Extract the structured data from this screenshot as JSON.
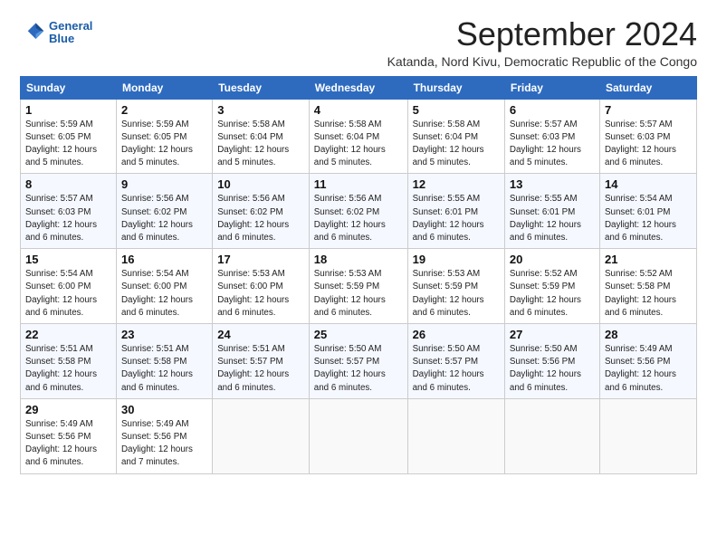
{
  "logo": {
    "line1": "General",
    "line2": "Blue"
  },
  "title": "September 2024",
  "location": "Katanda, Nord Kivu, Democratic Republic of the Congo",
  "headers": [
    "Sunday",
    "Monday",
    "Tuesday",
    "Wednesday",
    "Thursday",
    "Friday",
    "Saturday"
  ],
  "weeks": [
    [
      {
        "day": "1",
        "info": "Sunrise: 5:59 AM\nSunset: 6:05 PM\nDaylight: 12 hours\nand 5 minutes."
      },
      {
        "day": "2",
        "info": "Sunrise: 5:59 AM\nSunset: 6:05 PM\nDaylight: 12 hours\nand 5 minutes."
      },
      {
        "day": "3",
        "info": "Sunrise: 5:58 AM\nSunset: 6:04 PM\nDaylight: 12 hours\nand 5 minutes."
      },
      {
        "day": "4",
        "info": "Sunrise: 5:58 AM\nSunset: 6:04 PM\nDaylight: 12 hours\nand 5 minutes."
      },
      {
        "day": "5",
        "info": "Sunrise: 5:58 AM\nSunset: 6:04 PM\nDaylight: 12 hours\nand 5 minutes."
      },
      {
        "day": "6",
        "info": "Sunrise: 5:57 AM\nSunset: 6:03 PM\nDaylight: 12 hours\nand 5 minutes."
      },
      {
        "day": "7",
        "info": "Sunrise: 5:57 AM\nSunset: 6:03 PM\nDaylight: 12 hours\nand 6 minutes."
      }
    ],
    [
      {
        "day": "8",
        "info": "Sunrise: 5:57 AM\nSunset: 6:03 PM\nDaylight: 12 hours\nand 6 minutes."
      },
      {
        "day": "9",
        "info": "Sunrise: 5:56 AM\nSunset: 6:02 PM\nDaylight: 12 hours\nand 6 minutes."
      },
      {
        "day": "10",
        "info": "Sunrise: 5:56 AM\nSunset: 6:02 PM\nDaylight: 12 hours\nand 6 minutes."
      },
      {
        "day": "11",
        "info": "Sunrise: 5:56 AM\nSunset: 6:02 PM\nDaylight: 12 hours\nand 6 minutes."
      },
      {
        "day": "12",
        "info": "Sunrise: 5:55 AM\nSunset: 6:01 PM\nDaylight: 12 hours\nand 6 minutes."
      },
      {
        "day": "13",
        "info": "Sunrise: 5:55 AM\nSunset: 6:01 PM\nDaylight: 12 hours\nand 6 minutes."
      },
      {
        "day": "14",
        "info": "Sunrise: 5:54 AM\nSunset: 6:01 PM\nDaylight: 12 hours\nand 6 minutes."
      }
    ],
    [
      {
        "day": "15",
        "info": "Sunrise: 5:54 AM\nSunset: 6:00 PM\nDaylight: 12 hours\nand 6 minutes."
      },
      {
        "day": "16",
        "info": "Sunrise: 5:54 AM\nSunset: 6:00 PM\nDaylight: 12 hours\nand 6 minutes."
      },
      {
        "day": "17",
        "info": "Sunrise: 5:53 AM\nSunset: 6:00 PM\nDaylight: 12 hours\nand 6 minutes."
      },
      {
        "day": "18",
        "info": "Sunrise: 5:53 AM\nSunset: 5:59 PM\nDaylight: 12 hours\nand 6 minutes."
      },
      {
        "day": "19",
        "info": "Sunrise: 5:53 AM\nSunset: 5:59 PM\nDaylight: 12 hours\nand 6 minutes."
      },
      {
        "day": "20",
        "info": "Sunrise: 5:52 AM\nSunset: 5:59 PM\nDaylight: 12 hours\nand 6 minutes."
      },
      {
        "day": "21",
        "info": "Sunrise: 5:52 AM\nSunset: 5:58 PM\nDaylight: 12 hours\nand 6 minutes."
      }
    ],
    [
      {
        "day": "22",
        "info": "Sunrise: 5:51 AM\nSunset: 5:58 PM\nDaylight: 12 hours\nand 6 minutes."
      },
      {
        "day": "23",
        "info": "Sunrise: 5:51 AM\nSunset: 5:58 PM\nDaylight: 12 hours\nand 6 minutes."
      },
      {
        "day": "24",
        "info": "Sunrise: 5:51 AM\nSunset: 5:57 PM\nDaylight: 12 hours\nand 6 minutes."
      },
      {
        "day": "25",
        "info": "Sunrise: 5:50 AM\nSunset: 5:57 PM\nDaylight: 12 hours\nand 6 minutes."
      },
      {
        "day": "26",
        "info": "Sunrise: 5:50 AM\nSunset: 5:57 PM\nDaylight: 12 hours\nand 6 minutes."
      },
      {
        "day": "27",
        "info": "Sunrise: 5:50 AM\nSunset: 5:56 PM\nDaylight: 12 hours\nand 6 minutes."
      },
      {
        "day": "28",
        "info": "Sunrise: 5:49 AM\nSunset: 5:56 PM\nDaylight: 12 hours\nand 6 minutes."
      }
    ],
    [
      {
        "day": "29",
        "info": "Sunrise: 5:49 AM\nSunset: 5:56 PM\nDaylight: 12 hours\nand 6 minutes."
      },
      {
        "day": "30",
        "info": "Sunrise: 5:49 AM\nSunset: 5:56 PM\nDaylight: 12 hours\nand 7 minutes."
      },
      {
        "day": "",
        "info": ""
      },
      {
        "day": "",
        "info": ""
      },
      {
        "day": "",
        "info": ""
      },
      {
        "day": "",
        "info": ""
      },
      {
        "day": "",
        "info": ""
      }
    ]
  ]
}
